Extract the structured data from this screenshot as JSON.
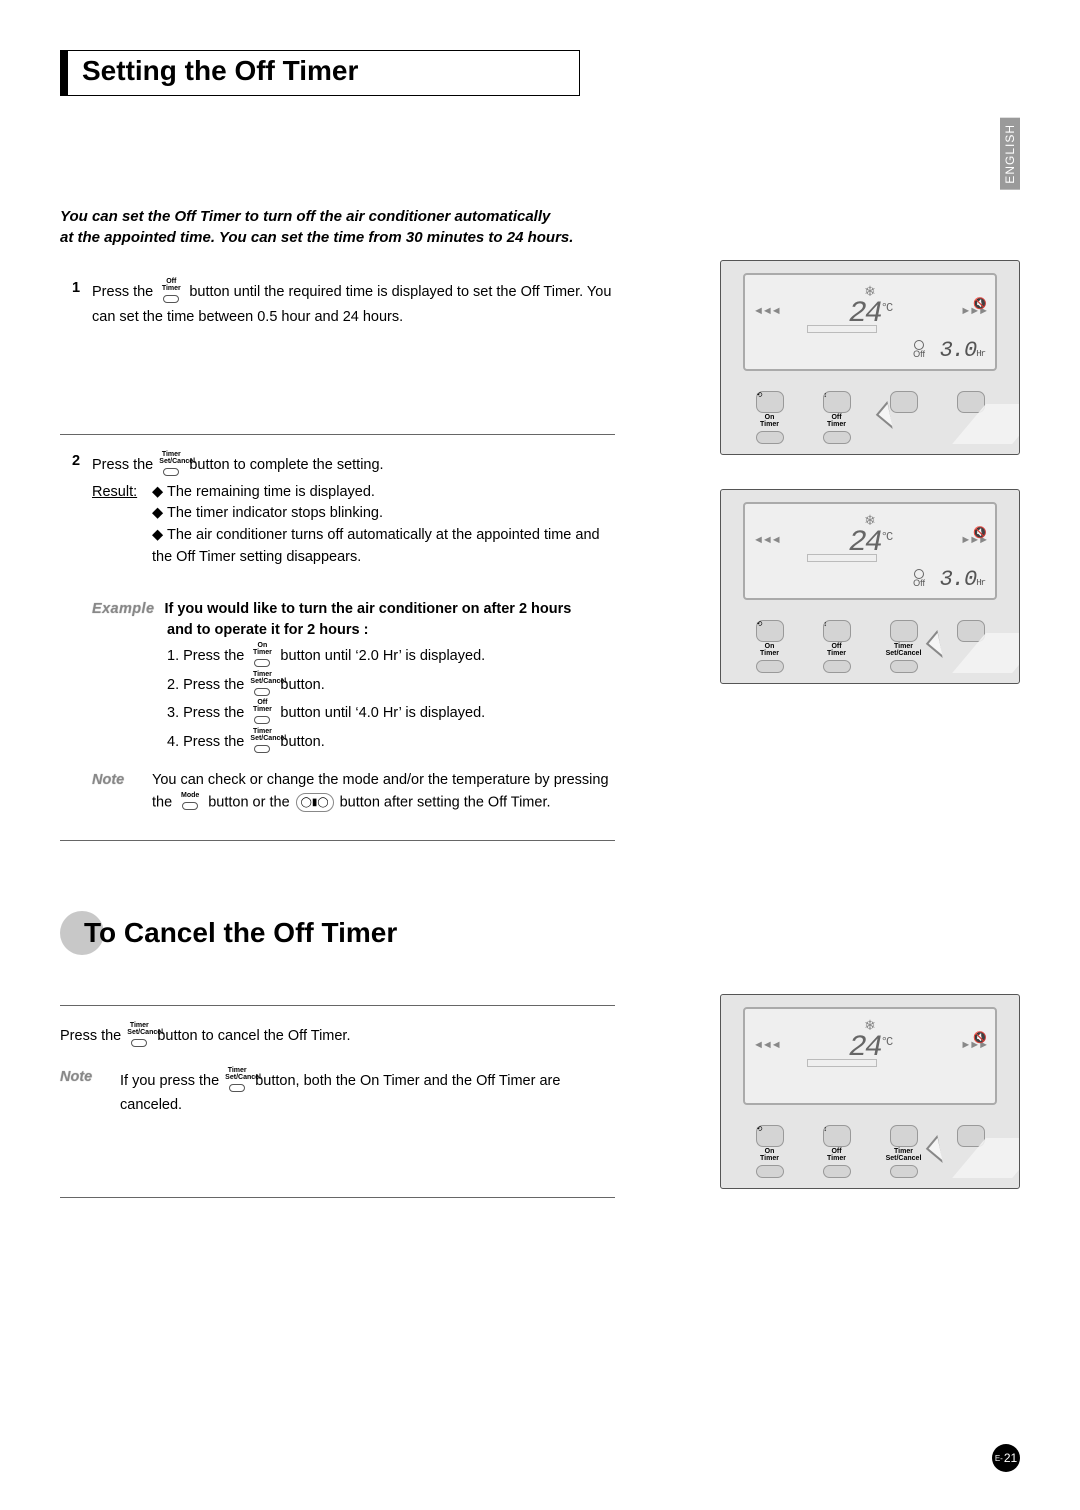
{
  "language_tab": "ENGLISH",
  "title": "Setting the Off Timer",
  "intro_line1": "You can set the Off Timer to turn off the air conditioner automatically",
  "intro_line2": "at the appointed time. You can set the time from 30 minutes to 24 hours.",
  "step1": {
    "num": "1",
    "pre": "Press the ",
    "btn_top": "Off",
    "btn_mid": "Timer",
    "post": " button until the required time is displayed to set the Off Timer. You can set the time between 0.5 hour and 24 hours."
  },
  "step2": {
    "num": "2",
    "pre": "Press the ",
    "btn_top": "Timer",
    "btn_mid": "Set/Cancel",
    "post": " button to complete the setting.",
    "result_label": "Result:",
    "r1": "The remaining time is displayed.",
    "r2": "The timer indicator stops blinking.",
    "r3": "The air conditioner turns off automatically at the appointed time and the Off Timer setting disappears."
  },
  "example": {
    "label": "Example",
    "lead1": "If you would like to turn the air conditioner on after 2 hours",
    "lead2": "and to operate it for 2 hours :",
    "s1_pre": "1. Press the ",
    "s1_btn_top": "On",
    "s1_btn_mid": "Timer",
    "s1_post": " button until ‘2.0 Hr’ is displayed.",
    "s2_pre": "2. Press the ",
    "s2_btn_top": "Timer",
    "s2_btn_mid": "Set/Cancel",
    "s2_post": " button.",
    "s3_pre": "3. Press the ",
    "s3_btn_top": "Off",
    "s3_btn_mid": "Timer",
    "s3_post": " button until ‘4.0 Hr’ is displayed.",
    "s4_pre": "4. Press the ",
    "s4_btn_top": "Timer",
    "s4_btn_mid": "Set/Cancel",
    "s4_post": " button."
  },
  "note1": {
    "label": "Note",
    "t1": "You can check or change the mode and/or the temperature by pressing the ",
    "mode_top": "Mode",
    "t2": " button or the ",
    "t3": " button after setting the Off Timer."
  },
  "section2_title": "To Cancel the Off Timer",
  "cancel": {
    "pre": "Press the ",
    "btn_top": "Timer",
    "btn_mid": "Set/Cancel",
    "post": " button to cancel the Off Timer."
  },
  "note2": {
    "label": "Note",
    "pre": "If you press the ",
    "btn_top": "Timer",
    "btn_mid": "Set/Cancel",
    "post": " button,  both the On Timer and the Off Timer are canceled."
  },
  "remote": {
    "snow": "❄",
    "arrows_left": "◄◄◄",
    "arrows_right": "►►►",
    "temp": "24",
    "deg": "°C",
    "sound": "🔇",
    "off_label": "Off",
    "off_value": "3.0",
    "hr": "Hr",
    "buttons": {
      "on_timer_top": "On",
      "on_timer_mid": "Timer",
      "off_timer_top": "Off",
      "off_timer_mid": "Timer",
      "set_cancel_top": "Timer",
      "set_cancel_mid": "Set/Cancel"
    }
  },
  "page_prefix": "E-",
  "page_number": "21"
}
